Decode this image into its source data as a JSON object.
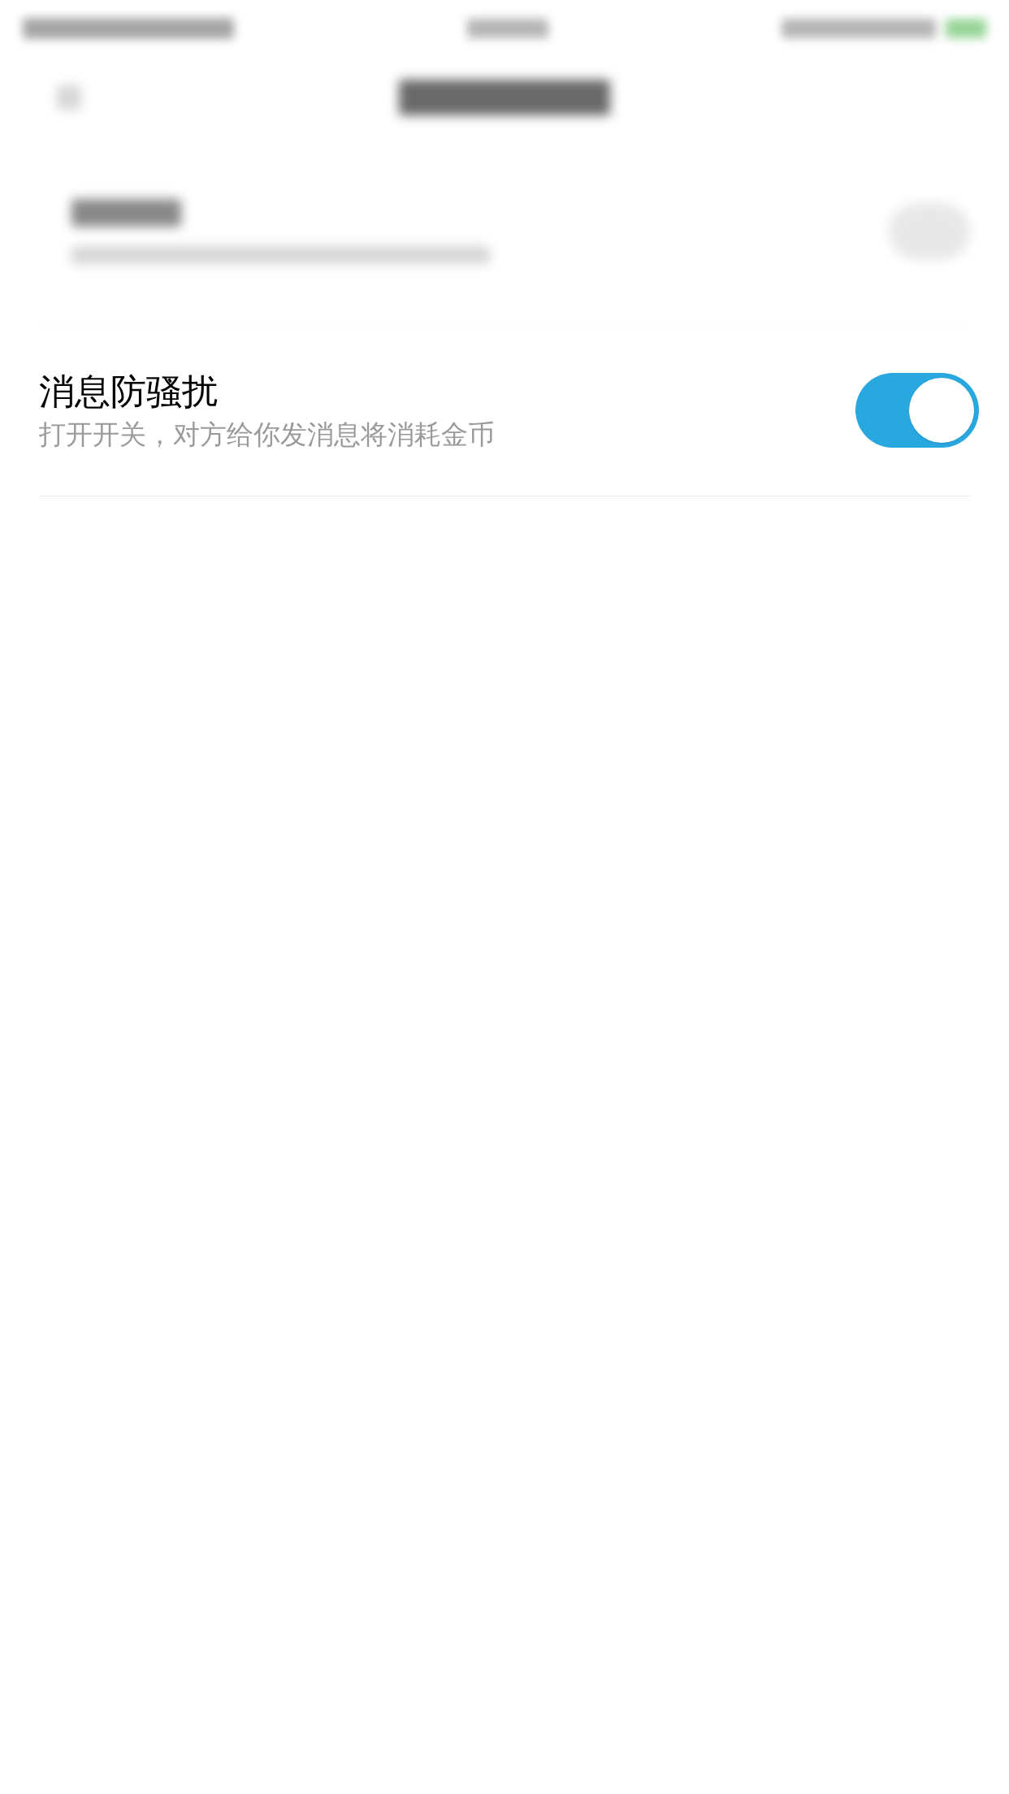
{
  "setting": {
    "title": "消息防骚扰",
    "description": "打开开关，对方给你发消息将消耗金币",
    "on": true
  }
}
